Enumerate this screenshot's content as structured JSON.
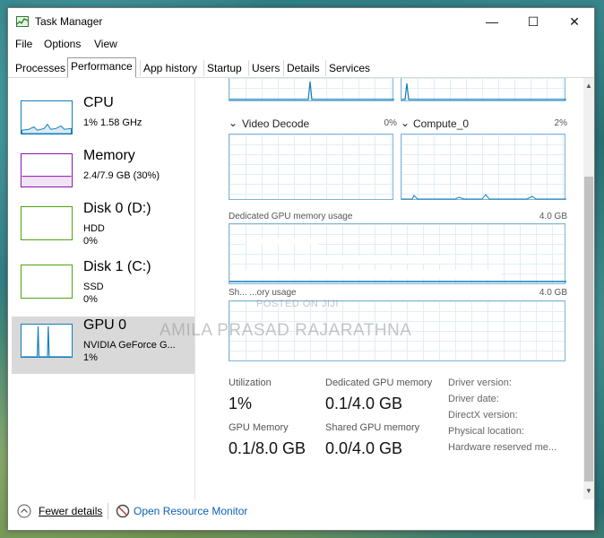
{
  "window": {
    "title": "Task Manager"
  },
  "menu": [
    "File",
    "Options",
    "View"
  ],
  "tabs": [
    "Processes",
    "Performance",
    "App history",
    "Startup",
    "Users",
    "Details",
    "Services"
  ],
  "sidebar": {
    "items": [
      {
        "title": "CPU",
        "sub1": "1% 1.58 GHz",
        "sub2": "",
        "sub3": "",
        "color": "#117dbb"
      },
      {
        "title": "Memory",
        "sub1": "2.4/7.9 GB (30%)",
        "sub2": "",
        "sub3": "",
        "color": "#8b12ae"
      },
      {
        "title": "Disk 0 (D:)",
        "sub1": "HDD",
        "sub2": "0%",
        "sub3": "",
        "color": "#4da60c"
      },
      {
        "title": "Disk 1 (C:)",
        "sub1": "SSD",
        "sub2": "0%",
        "sub3": "",
        "color": "#4da60c"
      },
      {
        "title": "GPU 0",
        "sub1": "NVIDIA GeForce G...",
        "sub2": "1%",
        "sub3": "",
        "color": "#117dbb"
      }
    ]
  },
  "main": {
    "engines": [
      {
        "name": "Video Decode",
        "pct": "0%"
      },
      {
        "name": "Compute_0",
        "pct": "2%"
      }
    ],
    "dedicated_label": "Dedicated GPU memory usage",
    "dedicated_max": "4.0 GB",
    "shared_label": "Sh... ...ory usage",
    "shared_max": "4.0 GB",
    "stats": {
      "utilization_label": "Utilization",
      "utilization_value": "1%",
      "dedicated_label": "Dedicated GPU memory",
      "dedicated_value": "0.1/4.0 GB",
      "gpu_memory_label": "GPU Memory",
      "gpu_memory_value": "0.1/8.0 GB",
      "shared_label": "Shared GPU memory",
      "shared_value": "0.0/4.0 GB"
    },
    "info": [
      "Driver version:",
      "Driver date:",
      "DirectX version:",
      "Physical location:",
      "Hardware reserved me..."
    ]
  },
  "footer": {
    "fewer_details": "Fewer details",
    "resource_monitor": "Open Resource Monitor"
  },
  "watermark": {
    "name": "AMILA PRASAD RAJARATHNA",
    "posted": "POSTED ON JIJI"
  },
  "colors": {
    "accent": "#117dbb",
    "link": "#0b5fb5",
    "memory": "#8b12ae",
    "disk": "#4da60c"
  }
}
